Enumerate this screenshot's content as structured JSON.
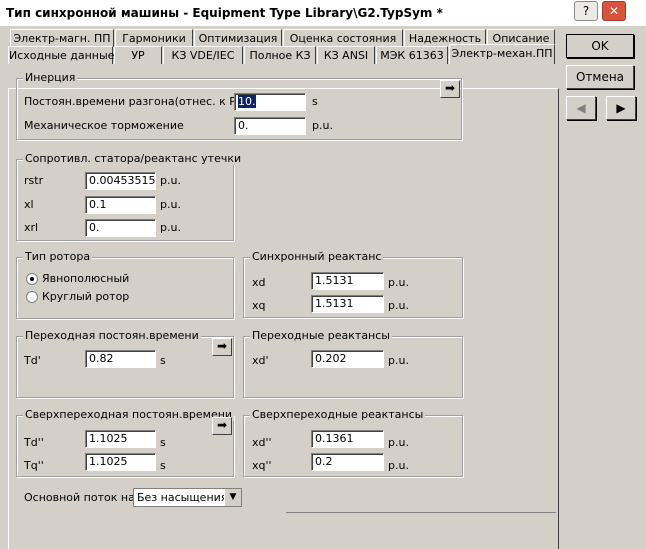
{
  "window": {
    "title": "Тип синхронной машины - Equipment Type Library\\G2.TypSym *",
    "help_label": "?",
    "close_label": "✕"
  },
  "tabs_row1": [
    {
      "label": "Электр-магн. ПП"
    },
    {
      "label": "Гармоники"
    },
    {
      "label": "Оптимизация"
    },
    {
      "label": "Оценка состояния"
    },
    {
      "label": "Надежность"
    },
    {
      "label": "Описание"
    }
  ],
  "tabs_row2": [
    {
      "label": "Исходные данные"
    },
    {
      "label": "УР"
    },
    {
      "label": "КЗ VDE/IEC"
    },
    {
      "label": "Полное КЗ"
    },
    {
      "label": "КЗ ANSI"
    },
    {
      "label": "МЭК 61363"
    },
    {
      "label": "Электр-механ.ПП"
    }
  ],
  "buttons": {
    "ok": "OK",
    "cancel": "Отмена"
  },
  "nav": {
    "prev": "◀",
    "next": "▶"
  },
  "inertia": {
    "title": "Инерция",
    "accel_label": "Постоян.времени разгона(отнес. к Pgn)",
    "accel_value": "10.",
    "accel_unit": "s",
    "mech_label": "Механическое торможение",
    "mech_value": "0.",
    "mech_unit": "p.u."
  },
  "stator": {
    "title": "Сопротивл. статора/реактанс утечки",
    "rstr_label": "rstr",
    "rstr_value": "0.00453515",
    "rstr_unit": "p.u.",
    "xl_label": "xl",
    "xl_value": "0.1",
    "xl_unit": "p.u.",
    "xrl_label": "xrl",
    "xrl_value": "0.",
    "xrl_unit": "p.u."
  },
  "rotor": {
    "title": "Тип ротора",
    "salient": "Явнополюсный",
    "round": "Круглый ротор"
  },
  "sync": {
    "title": "Синхронный реактанс",
    "xd_label": "xd",
    "xd_value": "1.5131",
    "xd_unit": "p.u.",
    "xq_label": "xq",
    "xq_value": "1.5131",
    "xq_unit": "p.u."
  },
  "transient_time": {
    "title": "Переходная постоян.времени",
    "td_label": "Td'",
    "td_value": "0.82",
    "td_unit": "s"
  },
  "transient_react": {
    "title": "Переходные реактансы",
    "xd_label": "xd'",
    "xd_value": "0.202",
    "xd_unit": "p.u."
  },
  "subtransient_time": {
    "title": "Сверхпереходная постоян.времени",
    "td_label": "Td''",
    "td_value": "1.1025",
    "td_unit": "s",
    "tq_label": "Tq''",
    "tq_value": "1.1025",
    "tq_unit": "s"
  },
  "subtransient_react": {
    "title": "Сверхпереходные реактансы",
    "xd_label": "xd''",
    "xd_value": "0.1361",
    "xd_unit": "p.u.",
    "xq_label": "xq''",
    "xq_value": "0.2",
    "xq_unit": "p.u."
  },
  "saturation": {
    "label": "Основной поток насы",
    "value": "Без насыщения"
  },
  "icons": {
    "arrow": "right-arrow-icon",
    "dropdown": "chevron-down-icon"
  }
}
